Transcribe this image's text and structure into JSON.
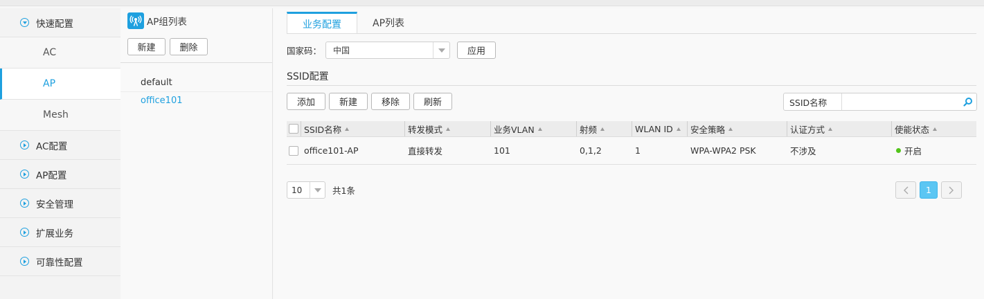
{
  "sidebar": {
    "items": [
      {
        "label": "快速配置",
        "expanded": true,
        "children": [
          {
            "label": "AC",
            "active": false
          },
          {
            "label": "AP",
            "active": true
          },
          {
            "label": "Mesh",
            "active": false
          }
        ]
      },
      {
        "label": "AC配置"
      },
      {
        "label": "AP配置"
      },
      {
        "label": "安全管理"
      },
      {
        "label": "扩展业务"
      },
      {
        "label": "可靠性配置"
      }
    ]
  },
  "group_panel": {
    "title": "AP组列表",
    "new_label": "新建",
    "delete_label": "删除",
    "groups": [
      "default",
      "office101"
    ],
    "active_group": "office101"
  },
  "main": {
    "tabs": [
      {
        "label": "业务配置",
        "active": true
      },
      {
        "label": "AP列表",
        "active": false
      }
    ],
    "country_label": "国家码：",
    "country_value": "中国",
    "apply_label": "应用",
    "section_title": "SSID配置",
    "toolbar": {
      "add": "添加",
      "new": "新建",
      "remove": "移除",
      "refresh": "刷新"
    },
    "search": {
      "label": "SSID名称",
      "value": ""
    },
    "table": {
      "columns": [
        "SSID名称",
        "转发模式",
        "业务VLAN",
        "射频",
        "WLAN ID",
        "安全策略",
        "认证方式",
        "使能状态"
      ],
      "rows": [
        {
          "ssid": "office101-AP",
          "forward": "直接转发",
          "vlan": "101",
          "radio": "0,1,2",
          "wlan_id": "1",
          "security": "WPA-WPA2 PSK",
          "auth": "不涉及",
          "status": "开启"
        }
      ]
    },
    "pagination": {
      "page_size": "10",
      "total": "共1条",
      "current_page": "1"
    }
  },
  "colors": {
    "accent": "#1ea0df",
    "status_on": "#52c41a",
    "page_active": "#5bc6f3"
  }
}
